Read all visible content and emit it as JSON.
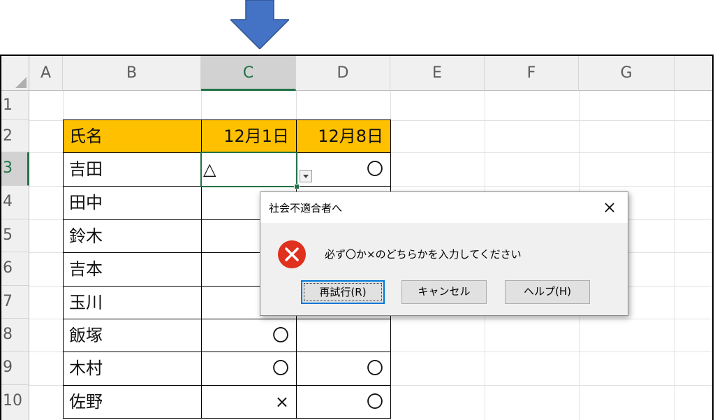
{
  "columns": [
    "A",
    "B",
    "C",
    "D",
    "E",
    "F",
    "G"
  ],
  "rows": [
    "1",
    "2",
    "3",
    "4",
    "5",
    "6",
    "7",
    "8",
    "9",
    "10"
  ],
  "table": {
    "header": {
      "name": "氏名",
      "date1": "12月1日",
      "date2": "12月8日"
    },
    "entries": [
      {
        "name": "吉田",
        "c": "△",
        "d": "〇"
      },
      {
        "name": "田中",
        "c": "",
        "d": ""
      },
      {
        "name": "鈴木",
        "c": "",
        "d": ""
      },
      {
        "name": "吉本",
        "c": "",
        "d": ""
      },
      {
        "name": "玉川",
        "c": "",
        "d": ""
      },
      {
        "name": "飯塚",
        "c": "〇",
        "d": ""
      },
      {
        "name": "木村",
        "c": "〇",
        "d": "〇"
      },
      {
        "name": "佐野",
        "c": "×",
        "d": "〇"
      }
    ]
  },
  "colors": {
    "header_fill": "#ffc000",
    "selection": "#217346",
    "arrow": "#4472c4",
    "error": "#e0301e"
  },
  "dialog": {
    "title": "社会不適合者へ",
    "message": "必ず〇か×のどちらかを入力してください",
    "icon": "error-icon",
    "buttons": {
      "retry": "再試行(R)",
      "cancel": "キャンセル",
      "help": "ヘルプ(H)"
    }
  }
}
